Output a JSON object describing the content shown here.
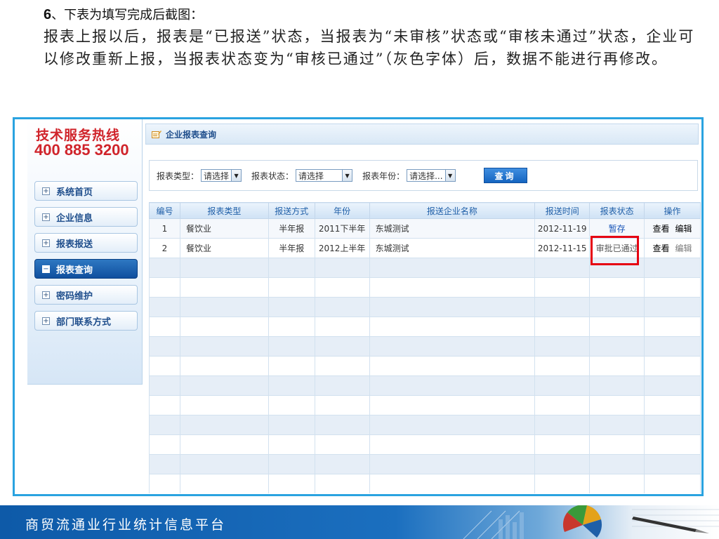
{
  "slide": {
    "heading_num": "6",
    "heading_text": "、下表为填写完成后截图：",
    "body": "报表上报以后，报表是“已报送”状态，当报表为“未审核”状态或“审核未通过”状态，企业可以修改重新上报，当报表状态变为“审核已通过”（灰色字体）后，数据不能进行再修改。",
    "footer": "商贸流通业行业统计信息平台"
  },
  "sidebar": {
    "hotline_title": "技术服务热线",
    "hotline_phone": "400 885 3200",
    "items": [
      {
        "label": "系统首页",
        "active": false
      },
      {
        "label": "企业信息",
        "active": false
      },
      {
        "label": "报表报送",
        "active": false
      },
      {
        "label": "报表查询",
        "active": true
      },
      {
        "label": "密码维护",
        "active": false
      },
      {
        "label": "部门联系方式",
        "active": false
      }
    ]
  },
  "main": {
    "title": "企业报表查询",
    "filters": {
      "type_label": "报表类型：",
      "type_value": "请选择",
      "status_label": "报表状态：",
      "status_value": "请选择",
      "year_label": "报表年份：",
      "year_value": "请选择...",
      "query_button": "查询"
    },
    "table": {
      "headers": [
        "编号",
        "报表类型",
        "报送方式",
        "年份",
        "报送企业名称",
        "报送时间",
        "报表状态",
        "操作"
      ],
      "rows": [
        {
          "no": "1",
          "type": "餐饮业",
          "method": "半年报",
          "year": "2011下半年",
          "company": "东城测试",
          "time": "2012-11-19",
          "status": "暂存",
          "view": "查看",
          "edit": "编辑"
        },
        {
          "no": "2",
          "type": "餐饮业",
          "method": "半年报",
          "year": "2012上半年",
          "company": "东城测试",
          "time": "2012-11-15",
          "status": "审批已通过",
          "view": "查看",
          "edit": "编辑"
        }
      ]
    }
  },
  "colors": {
    "accent": "#2aa3e0",
    "hotline": "#d0242b",
    "highlight": "#e60012",
    "nav_active": "#0f4f9e"
  }
}
